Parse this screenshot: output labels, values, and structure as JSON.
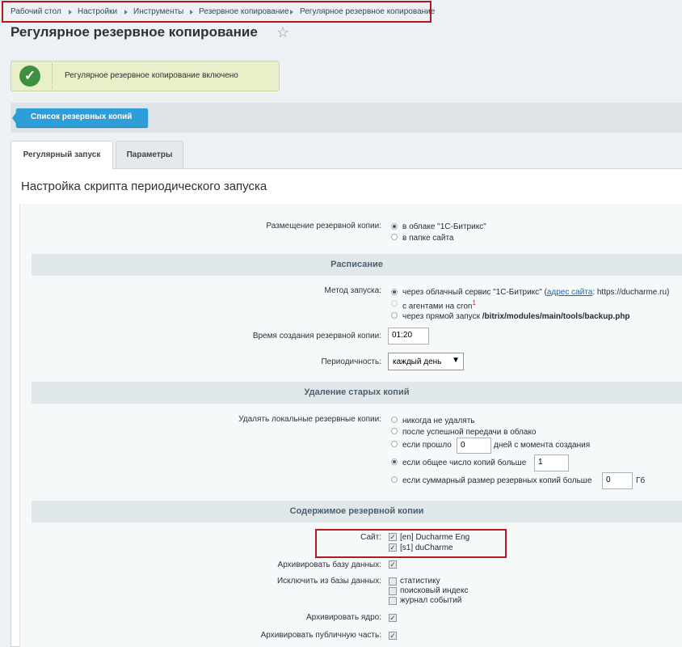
{
  "breadcrumb": [
    "Рабочий стол",
    "Настройки",
    "Инструменты",
    "Резервное копирование",
    "Регулярное резервное копирование"
  ],
  "page_title": "Регулярное резервное копирование",
  "success_message": "Регулярное резервное копирование включено",
  "toolbar": {
    "list_button": "Список резервных копий"
  },
  "tabs": [
    "Регулярный запуск",
    "Параметры"
  ],
  "section_title": "Настройка скрипта периодического запуска",
  "placement": {
    "label": "Размещение резервной копии:",
    "options": [
      "в облаке \"1С-Битрикс\"",
      "в папке сайта"
    ]
  },
  "schedule": {
    "header": "Расписание",
    "method_label": "Метод запуска:",
    "method_opt1_prefix": "через облачный сервис \"1С-Битрикс\" (",
    "method_opt1_link": "адрес сайта",
    "method_opt1_suffix": ": https://ducharme.ru)",
    "method_opt2": "с агентами на cron",
    "method_opt2_sup": "1",
    "method_opt3_prefix": "через прямой запуск ",
    "method_opt3_path": "/bitrix/modules/main/tools/backup.php",
    "time_label": "Время создания резервной копии:",
    "time_value": "01:20",
    "period_label": "Периодичность:",
    "period_value": "каждый день"
  },
  "cleanup": {
    "header": "Удаление старых копий",
    "label": "Удалять локальные резервные копии:",
    "opt1": "никогда не удалять",
    "opt2": "после успешной передачи в облако",
    "opt3_prefix": "если прошло",
    "opt3_value": "0",
    "opt3_suffix": "дней с момента создания",
    "opt4_prefix": "если общее число копий больше",
    "opt4_value": "1",
    "opt5_prefix": "если суммарный размер резервных копий больше",
    "opt5_value": "0",
    "opt5_suffix": "Гб"
  },
  "content": {
    "header": "Содержимое резервной копии",
    "site_label": "Сайт:",
    "sites": [
      "[en] Ducharme Eng",
      "[s1] duCharme"
    ],
    "archive_db_label": "Архивировать базу данных:",
    "exclude_label": "Исключить из базы данных:",
    "exclude_options": [
      "статистику",
      "поисковый индекс",
      "журнал событий"
    ],
    "archive_core_label": "Архивировать ядро:",
    "archive_public_label": "Архивировать публичную часть:"
  },
  "colors": {
    "accent_button": "#2e9ed8",
    "success_bg": "#e8efc9",
    "success_icon": "#3e8f3f",
    "highlight_border": "#b0191e"
  }
}
